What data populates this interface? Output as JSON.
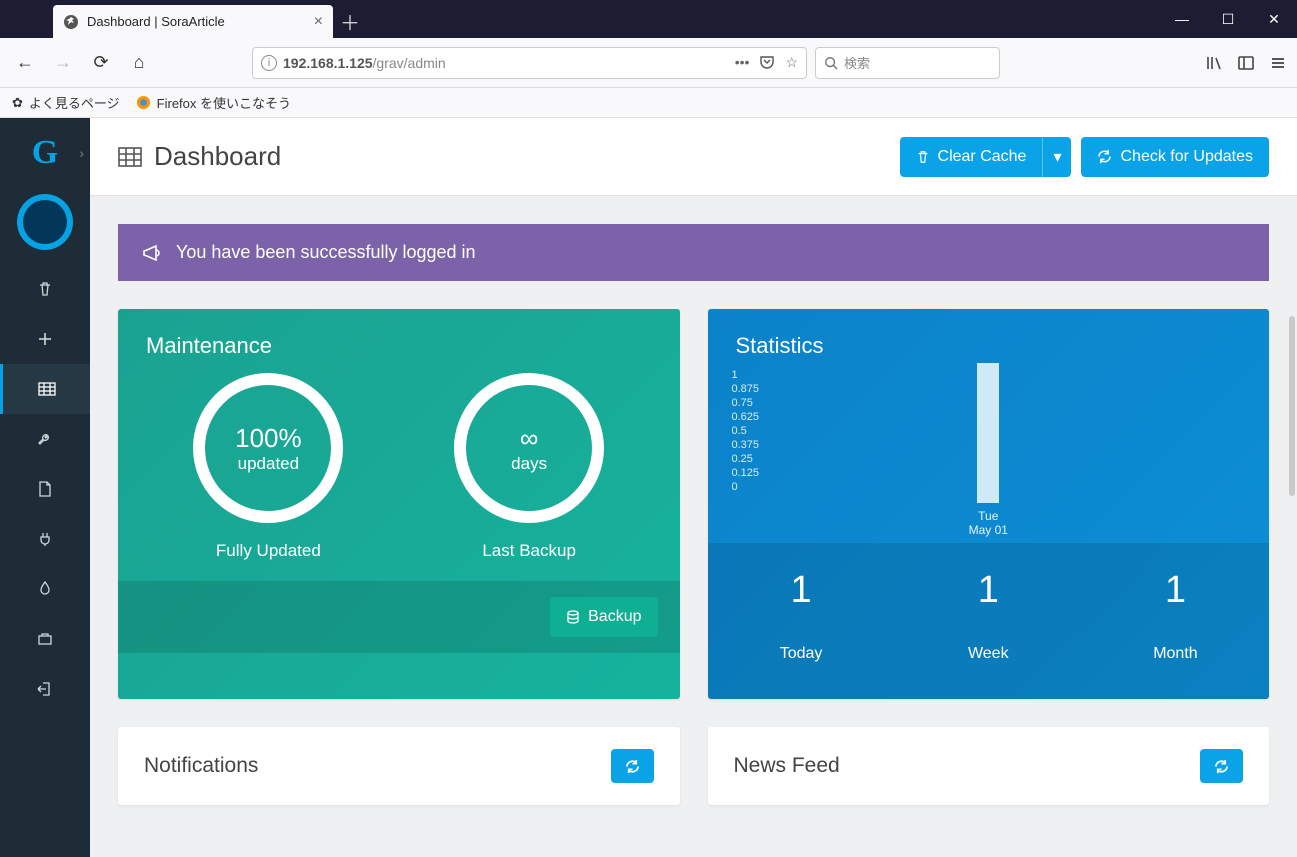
{
  "browser": {
    "tab_title": "Dashboard | SoraArticle",
    "url_host": "192.168.1.125",
    "url_path": "/grav/admin",
    "search_placeholder": "検索",
    "bookmarks": [
      {
        "label": "よく見るページ"
      },
      {
        "label": "Firefox を使いこなそう"
      }
    ]
  },
  "header": {
    "title": "Dashboard",
    "clear_cache": "Clear Cache",
    "check_updates": "Check for Updates"
  },
  "alert": "You have been successfully logged in",
  "maintenance": {
    "title": "Maintenance",
    "updated_pct": "100%",
    "updated_sub": "updated",
    "updated_caption": "Fully Updated",
    "backup_value": "∞",
    "backup_sub": "days",
    "backup_caption": "Last Backup",
    "backup_button": "Backup"
  },
  "statistics": {
    "title": "Statistics",
    "yticks": [
      "1",
      "0.875",
      "0.75",
      "0.625",
      "0.5",
      "0.375",
      "0.25",
      "0.125",
      "0"
    ],
    "xlabel_line1": "Tue",
    "xlabel_line2": "May 01",
    "today_n": "1",
    "today_l": "Today",
    "week_n": "1",
    "week_l": "Week",
    "month_n": "1",
    "month_l": "Month"
  },
  "panels": {
    "notifications": "Notifications",
    "newsfeed": "News Feed"
  },
  "chart_data": {
    "type": "bar",
    "categories": [
      "Tue May 01"
    ],
    "values": [
      1
    ],
    "title": "Statistics",
    "xlabel": "",
    "ylabel": "",
    "ylim": [
      0,
      1
    ]
  }
}
